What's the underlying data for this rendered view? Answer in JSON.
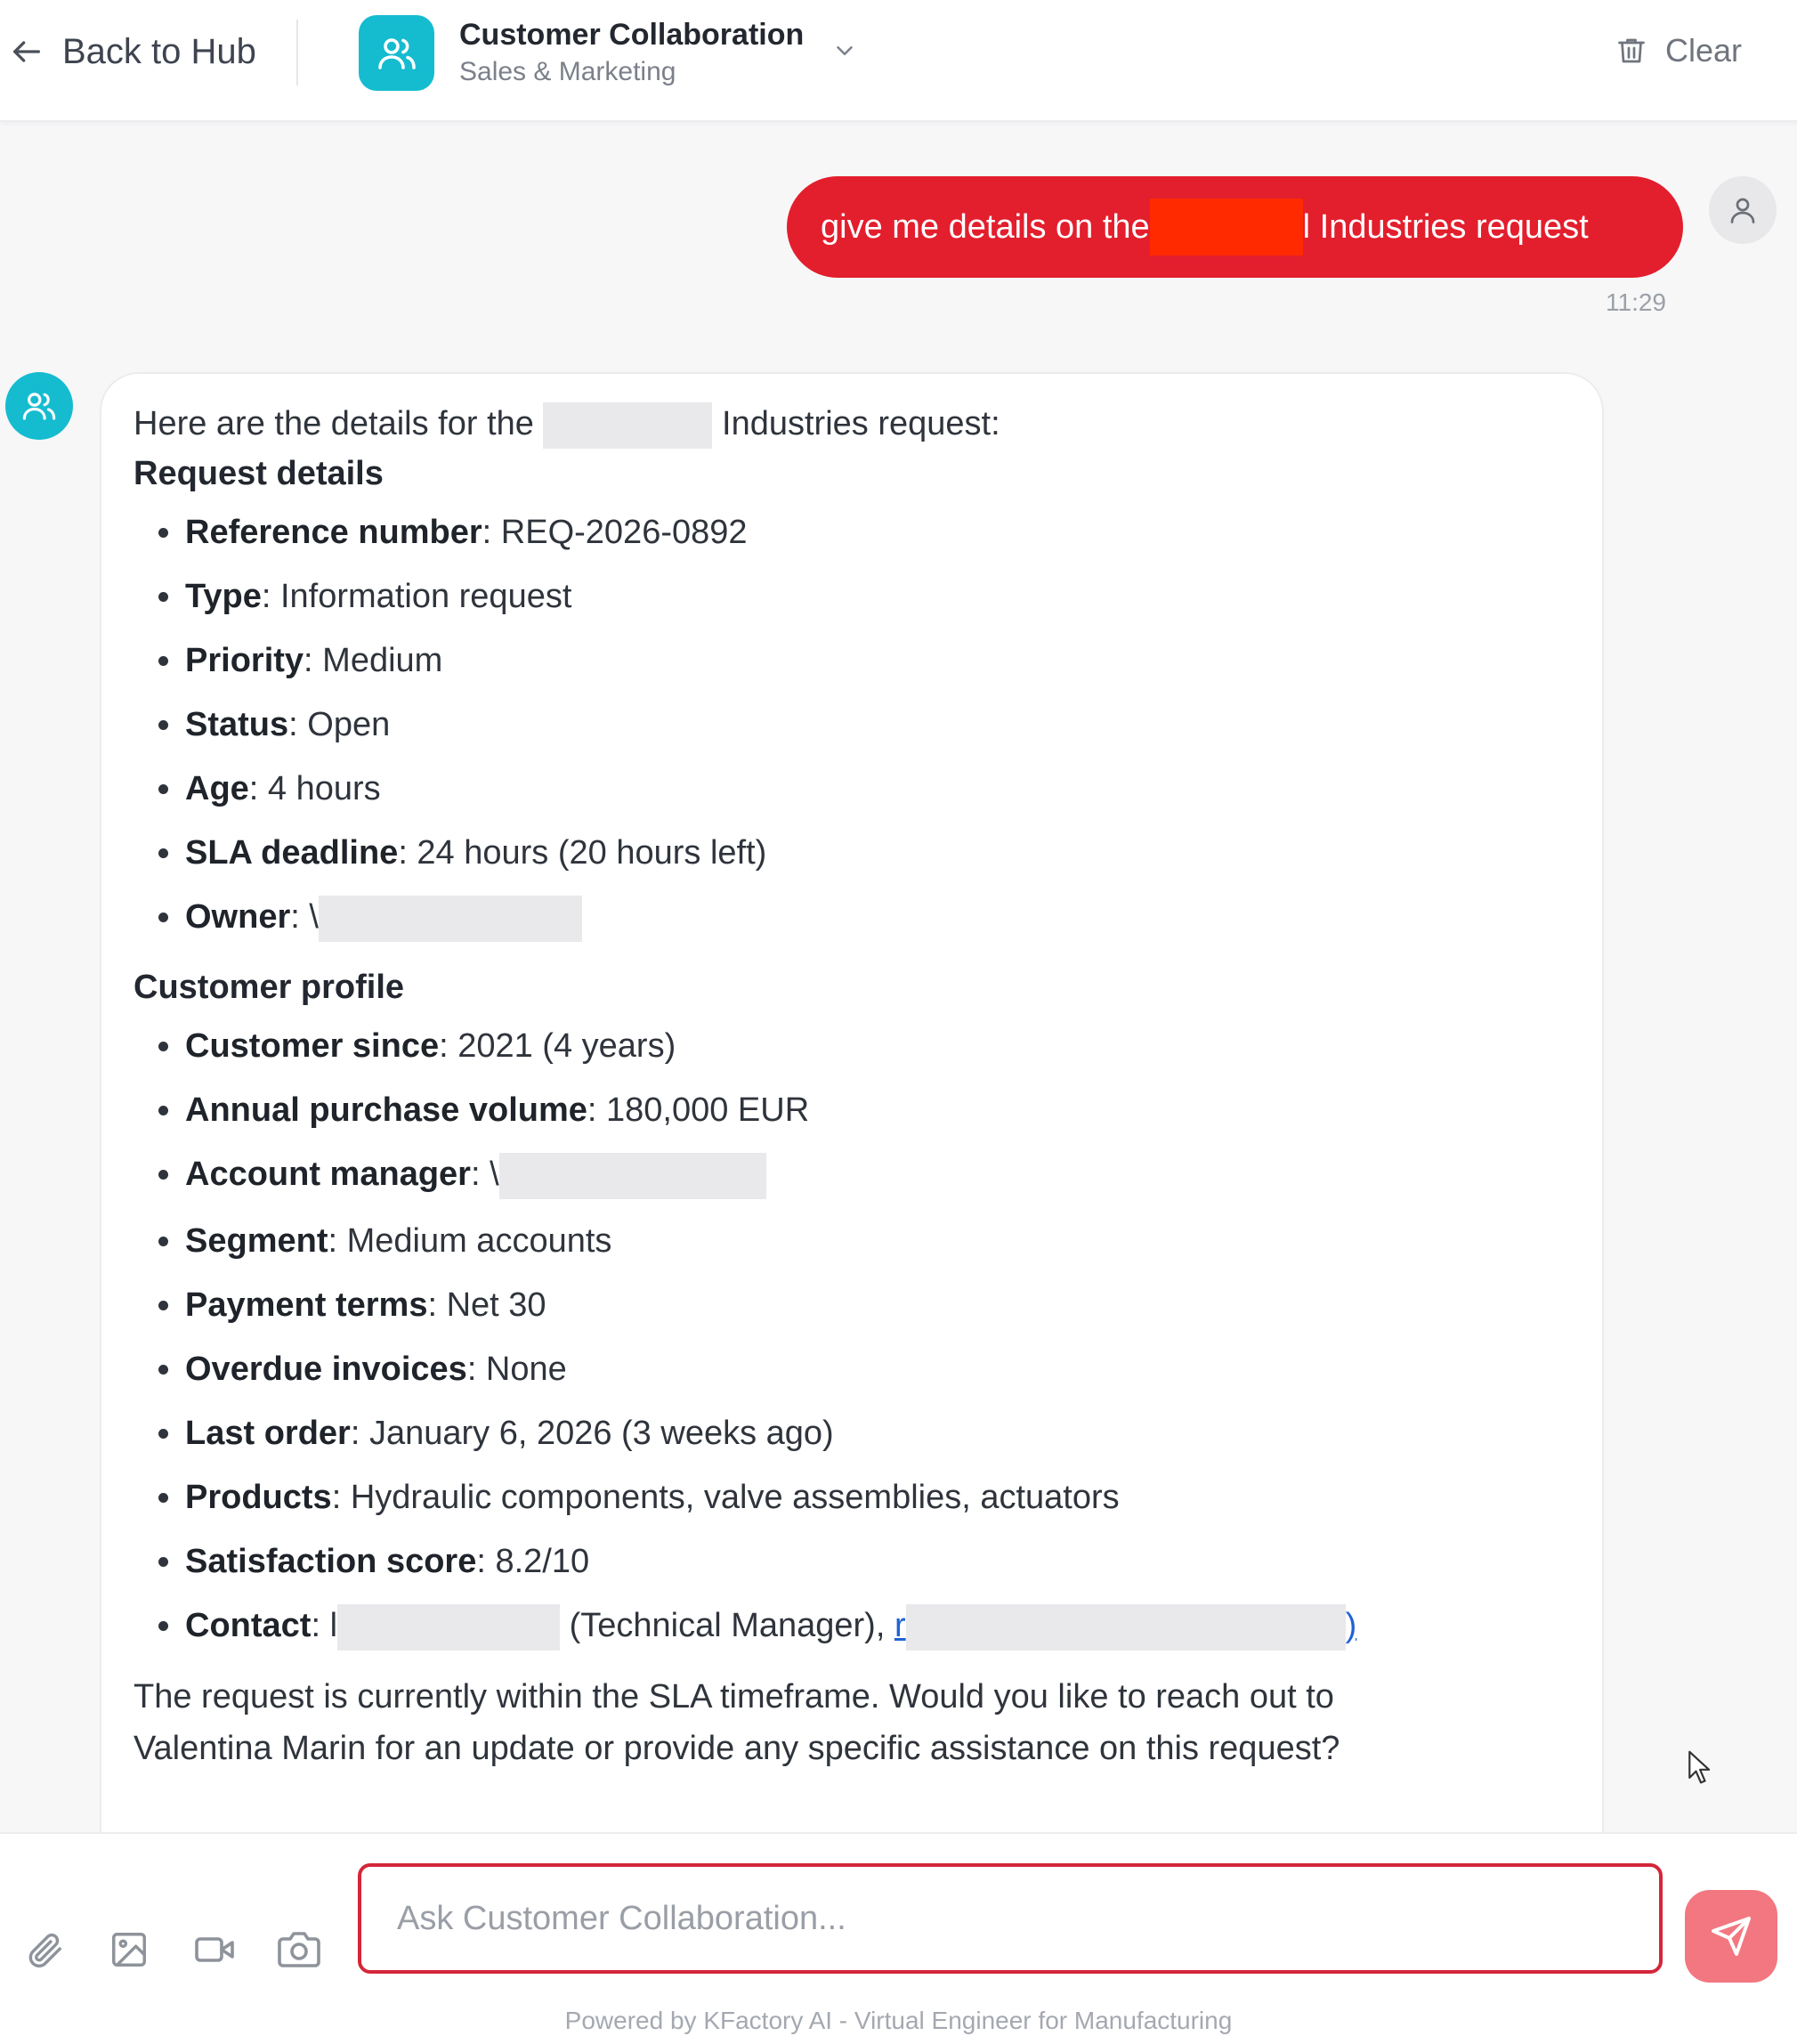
{
  "header": {
    "back_label": "Back to Hub",
    "agent_title": "Customer Collaboration",
    "agent_subtitle": "Sales & Marketing",
    "clear_label": "Clear",
    "accent_color": "#15bcd0"
  },
  "user_message": {
    "text_before": "give me details on the ",
    "text_after": "l Industries request",
    "time": "11:29",
    "bubble_color": "#e31e2d"
  },
  "assistant_message": {
    "intro_before": "Here are the details for the ",
    "intro_after": " Industries request:",
    "section1_title": "Request details",
    "request_details": [
      {
        "label": "Reference number",
        "value": ": REQ-2026-0892"
      },
      {
        "label": "Type",
        "value": ": Information request"
      },
      {
        "label": "Priority",
        "value": ": Medium"
      },
      {
        "label": "Status",
        "value": ": Open"
      },
      {
        "label": "Age",
        "value": ": 4 hours"
      },
      {
        "label": "SLA deadline",
        "value": ": 24 hours (20 hours left)"
      },
      {
        "label": "Owner",
        "value": ": \\"
      }
    ],
    "section2_title": "Customer profile",
    "customer_profile": [
      {
        "label": "Customer since",
        "value": ": 2021 (4 years)"
      },
      {
        "label": "Annual purchase volume",
        "value": ": 180,000 EUR"
      },
      {
        "label": "Account manager",
        "value": ": \\"
      },
      {
        "label": "Segment",
        "value": ": Medium accounts"
      },
      {
        "label": "Payment terms",
        "value": ": Net 30"
      },
      {
        "label": "Overdue invoices",
        "value": ": None"
      },
      {
        "label": "Last order",
        "value": ": January 6, 2026 (3 weeks ago)"
      },
      {
        "label": "Products",
        "value": ": Hydraulic components, valve assemblies, actuators"
      },
      {
        "label": "Satisfaction score",
        "value": ": 8.2/10"
      }
    ],
    "contact": {
      "label": "Contact",
      "value_before": ": l",
      "role": " (Technical Manager), ",
      "link_start": "r",
      "link_end": ")"
    },
    "closing_line1": "The request is currently within the SLA timeframe. Would you like to reach out to",
    "closing_line2": "Valentina Marin for an update or provide any specific assistance on this request?"
  },
  "composer": {
    "placeholder": "Ask Customer Collaboration...",
    "tools": [
      "paperclip-icon",
      "image-icon",
      "video-icon",
      "camera-icon"
    ],
    "send_color": "#f27780"
  },
  "footer": {
    "text": "Powered by KFactory AI - Virtual Engineer for Manufacturing"
  }
}
